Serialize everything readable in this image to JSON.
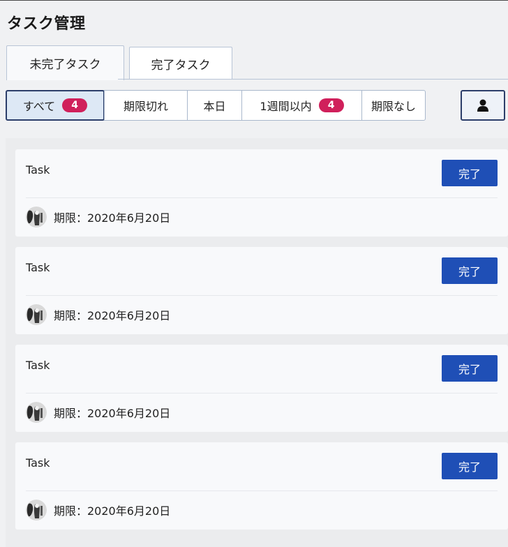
{
  "app": {
    "title": "タスク管理"
  },
  "tabs": [
    {
      "label": "未完了タスク",
      "active": true
    },
    {
      "label": "完了タスク",
      "active": false
    }
  ],
  "filters": [
    {
      "label": "すべて",
      "badge": "4",
      "active": true
    },
    {
      "label": "期限切れ"
    },
    {
      "label": "本日"
    },
    {
      "label": "1週間以内",
      "badge": "4"
    },
    {
      "label": "期限なし"
    }
  ],
  "user_button": {
    "icon": "user-icon"
  },
  "tasks": [
    {
      "title": "Task",
      "action": "完了",
      "due": "期限：2020年6月20日"
    },
    {
      "title": "Task",
      "action": "完了",
      "due": "期限：2020年6月20日"
    },
    {
      "title": "Task",
      "action": "完了",
      "due": "期限：2020年6月20日"
    },
    {
      "title": "Task",
      "action": "完了",
      "due": "期限：2020年6月20日"
    }
  ],
  "colors": {
    "accent": "#1f4fb6",
    "badge": "#d0205b",
    "active_filter_bg": "#dde8f5"
  }
}
